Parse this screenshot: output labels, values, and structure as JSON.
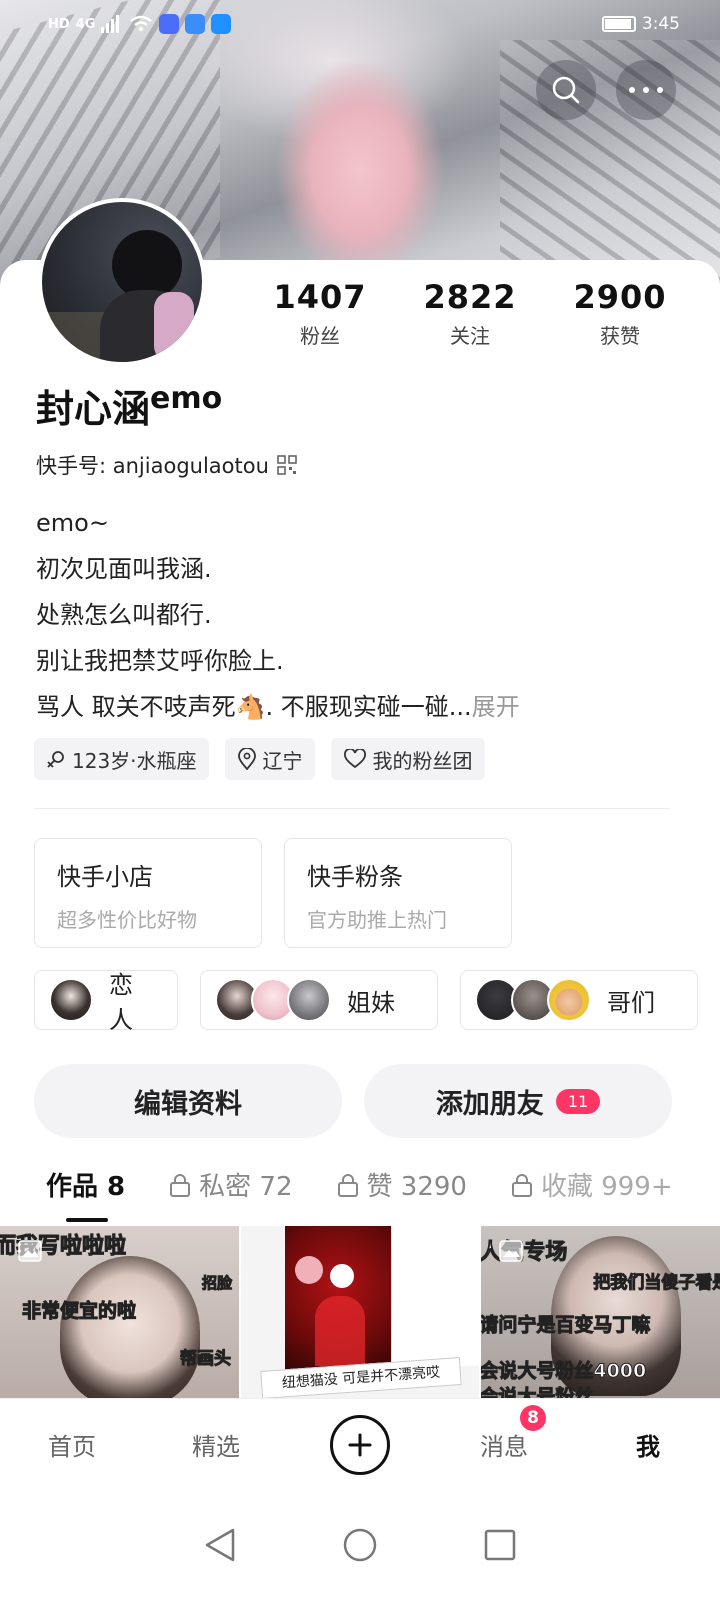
{
  "status_bar": {
    "network": "HD",
    "signal": "4G",
    "time": "3:45"
  },
  "profile": {
    "nickname": "封心涵",
    "nickname_suffix": "emo",
    "kuaishou_id": "快手号: anjiaogulaotou",
    "stats": [
      {
        "value": "1407",
        "label": "粉丝"
      },
      {
        "value": "2822",
        "label": "关注"
      },
      {
        "value": "2900",
        "label": "获赞"
      }
    ],
    "bio_lines": [
      "emo~",
      "初次见面叫我涵.",
      "处熟怎么叫都行.",
      "别让我把禁艾呼你脸上.",
      "骂人 取关不吱声死🐴. 不服现实碰一碰..."
    ],
    "bio_more": "展开",
    "tags": [
      {
        "icon": "gender-female-icon",
        "label": "123岁·水瓶座"
      },
      {
        "icon": "location-icon",
        "label": "辽宁"
      },
      {
        "icon": "heart-icon",
        "label": "我的粉丝团"
      }
    ]
  },
  "shops": [
    {
      "title": "快手小店",
      "subtitle": "超多性价比好物"
    },
    {
      "title": "快手粉条",
      "subtitle": "官方助推上热门"
    }
  ],
  "relations": [
    {
      "label": "恋人",
      "count": 1
    },
    {
      "label": "姐妹",
      "count": 3
    },
    {
      "label": "哥们",
      "count": 3
    }
  ],
  "actions": {
    "edit": "编辑资料",
    "add_friend": "添加朋友",
    "add_friend_badge": "11"
  },
  "tabs": [
    {
      "label": "作品 8",
      "locked": false
    },
    {
      "label": "私密 72",
      "locked": true
    },
    {
      "label": "赞 3290",
      "locked": true
    },
    {
      "label": "收藏 999+",
      "locked": true
    }
  ],
  "grid_captions": {
    "cell1_top": "而我写啦啦啦",
    "cell1_mid": "非常便宜的啦",
    "cell1_right1": "招脸",
    "cell1_right2": "帮画头",
    "cell2_strip": "纽想猫没 可是并不漂亮哎",
    "cell3_top": "人气专场",
    "cell3_line1": "把我们当傻子看是",
    "cell3_line2": "请问宁是百变马丁嘛",
    "cell3_line3": "会说大号粉丝4000",
    "cell3_line4": "会说大号粉丝"
  },
  "bottom_nav": {
    "home": "首页",
    "featured": "精选",
    "messages": "消息",
    "messages_badge": "8",
    "me": "我"
  },
  "colors": {
    "accent": "#fe3666",
    "text": "#222222",
    "chip_bg": "#f3f3f5"
  }
}
